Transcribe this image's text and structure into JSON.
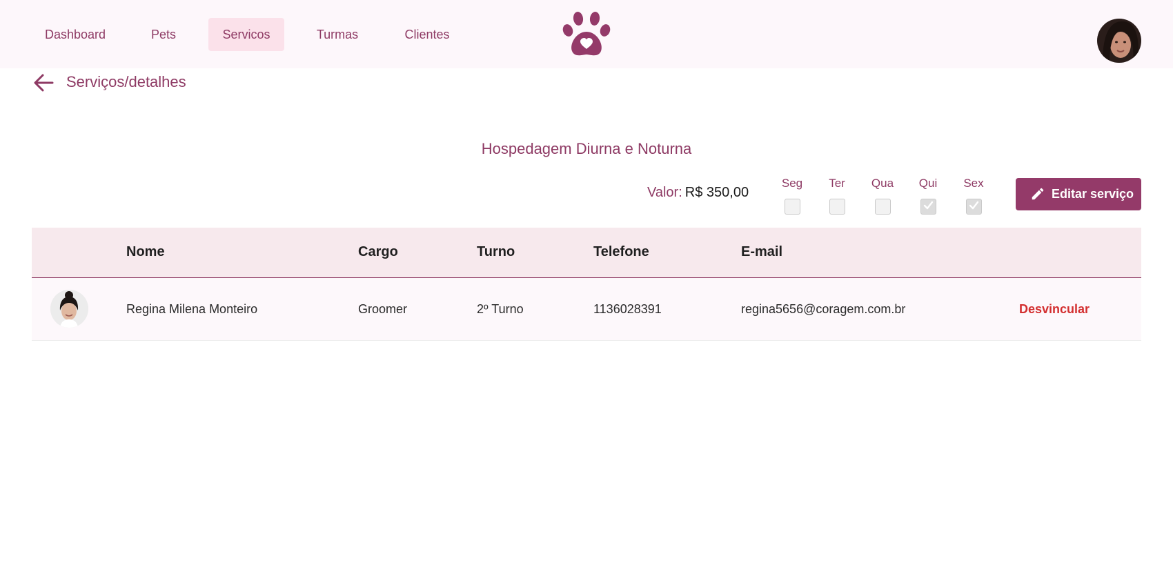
{
  "nav": {
    "items": [
      {
        "label": "Dashboard"
      },
      {
        "label": "Pets"
      },
      {
        "label": "Servicos"
      },
      {
        "label": "Turmas"
      },
      {
        "label": "Clientes"
      }
    ],
    "active": "Servicos"
  },
  "header": {
    "logo_icon": "paw-heart-icon",
    "avatar_icon": "user-avatar"
  },
  "page": {
    "title": "Serviços/detalhes",
    "back_icon": "arrow-left-icon"
  },
  "service": {
    "name": "Hospedagem Diurna e Noturna",
    "valor_label": "Valor:",
    "valor": "R$ 350,00",
    "days": [
      {
        "label": "Seg",
        "checked": false
      },
      {
        "label": "Ter",
        "checked": false
      },
      {
        "label": "Qua",
        "checked": false
      },
      {
        "label": "Qui",
        "checked": true
      },
      {
        "label": "Sex",
        "checked": true
      }
    ],
    "edit_label": "Editar serviço",
    "edit_icon": "pencil-icon"
  },
  "table": {
    "headers": [
      "Nome",
      "Cargo",
      "Turno",
      "Telefone",
      "E-mail"
    ],
    "rows": [
      {
        "nome": "Regina Milena Monteiro",
        "cargo": "Groomer",
        "turno": "2º Turno",
        "telefone": "1136028391",
        "email": "regina5656@coragem.com.br",
        "action": "Desvincular"
      }
    ]
  },
  "colors": {
    "primary": "#943a69",
    "nav_active_bg": "#fbe1ea",
    "header_bg": "#fdf7fb",
    "table_head_bg": "#f7e9ed",
    "danger": "#d32f2f"
  }
}
